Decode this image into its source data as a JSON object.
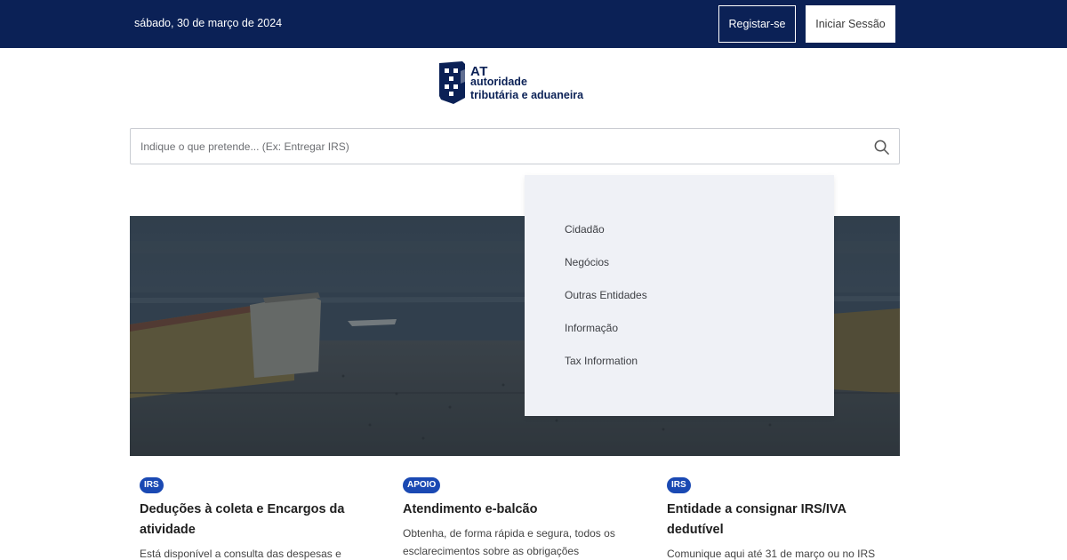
{
  "header": {
    "date": "sábado, 30 de março de 2024",
    "register_label": "Registar-se",
    "login_label": "Iniciar Sessão"
  },
  "logo": {
    "line1": "AT",
    "line2": "autoridade",
    "line3": "tributária e aduaneira"
  },
  "search": {
    "placeholder": "Indique o que pretende... (Ex: Entregar IRS)",
    "icon": "search-icon"
  },
  "menu": {
    "items": [
      {
        "label": "Cidadão"
      },
      {
        "label": "Negócios"
      },
      {
        "label": "Outras Entidades"
      },
      {
        "label": "Informação"
      },
      {
        "label": "Tax Information"
      }
    ]
  },
  "cards": [
    {
      "tag": "IRS",
      "title": "Deduções à coleta e Encargos da atividade",
      "text": "Está disponível a consulta das despesas e"
    },
    {
      "tag": "APOIO",
      "title": "Atendimento e-balcão",
      "text": "Obtenha, de forma rápida e segura, todos os esclarecimentos sobre as obrigações"
    },
    {
      "tag": "IRS",
      "title": "Entidade a consignar IRS/IVA dedutível",
      "text": "Comunique aqui até 31 de março ou no IRS"
    }
  ],
  "colors": {
    "header_bg": "#0b2156",
    "badge_bg": "#1a49b3",
    "menu_bg": "#eff1f6"
  }
}
